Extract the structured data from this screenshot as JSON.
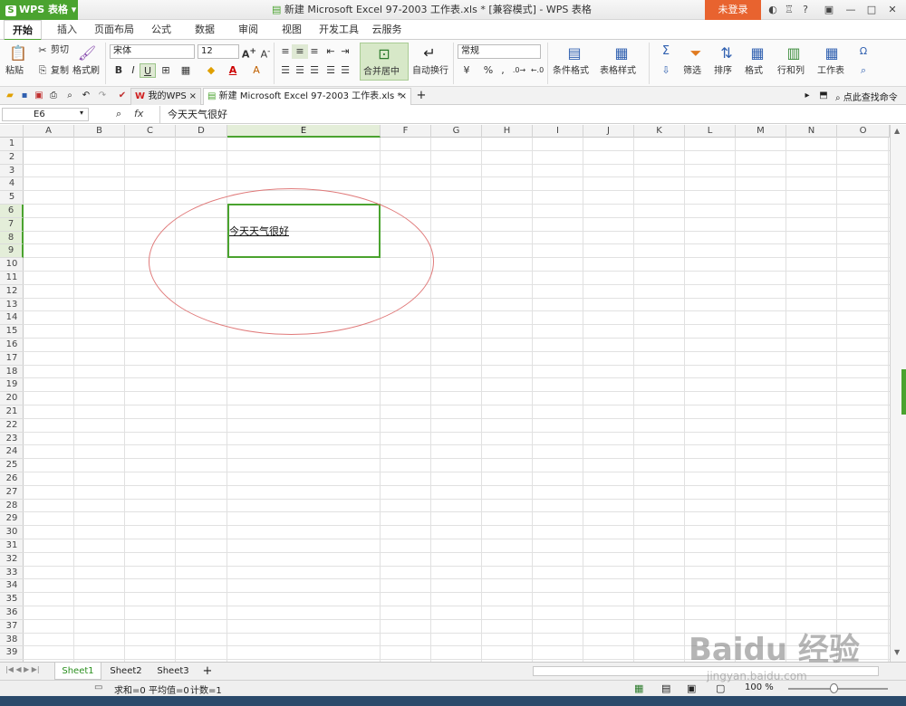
{
  "titlebar": {
    "app_button": "WPS 表格",
    "doc_title": "新建 Microsoft Excel 97-2003 工作表.xls * [兼容模式] - WPS 表格",
    "login": "未登录"
  },
  "menu": {
    "tabs": [
      "开始",
      "插入",
      "页面布局",
      "公式",
      "数据",
      "审阅",
      "视图",
      "开发工具",
      "云服务"
    ]
  },
  "ribbon": {
    "paste": "粘贴",
    "cut": "剪切",
    "copy": "复制",
    "format_painter": "格式刷",
    "font_name": "宋体",
    "font_size": "12",
    "merge_center": "合并居中",
    "wrap_text": "自动换行",
    "number_format": "常规",
    "conditional_format": "条件格式",
    "table_style": "表格样式",
    "filter": "筛选",
    "sort": "排序",
    "format": "格式",
    "rows_cols": "行和列",
    "worksheet": "工作表",
    "bold": "B",
    "italic": "I",
    "underline": "U",
    "percent": "%",
    "thousands": ",",
    "sum": "Σ"
  },
  "quickbar": {
    "tab_mywps": "我的WPS",
    "tab_doc": "新建 Microsoft Excel 97-2003 工作表.xls *",
    "search_cmd": "点此查找命令"
  },
  "formula_bar": {
    "name_box": "E6",
    "fx": "fx",
    "content": "今天天气很好"
  },
  "grid": {
    "columns": [
      "A",
      "B",
      "C",
      "D",
      "E",
      "F",
      "G",
      "H",
      "I",
      "J",
      "K",
      "L",
      "M",
      "N",
      "O"
    ],
    "rows": [
      "1",
      "2",
      "3",
      "4",
      "5",
      "6",
      "7",
      "8",
      "9",
      "10",
      "11",
      "12",
      "13",
      "14",
      "15",
      "16",
      "17",
      "18",
      "19",
      "20",
      "21",
      "22",
      "23",
      "24",
      "25",
      "26",
      "27",
      "28",
      "29",
      "30",
      "31",
      "32",
      "33",
      "34",
      "35",
      "36",
      "37",
      "38",
      "39"
    ],
    "selected_column": "E",
    "selected_rows": [
      "6",
      "7",
      "8",
      "9"
    ],
    "cell_e6": "今天天气很好"
  },
  "sheets": {
    "tabs": [
      "Sheet1",
      "Sheet2",
      "Sheet3"
    ],
    "active": "Sheet1",
    "add": "+"
  },
  "status": {
    "sum": "求和=0",
    "avg": "平均值=0",
    "count": "计数=1",
    "zoom": "100 %"
  },
  "watermark": {
    "logo": "Baidu 经验",
    "url": "jingyan.baidu.com"
  },
  "colors": {
    "brand_green": "#4aa32f",
    "login_orange": "#e8632f",
    "annotation_red": "#e07a7a"
  }
}
